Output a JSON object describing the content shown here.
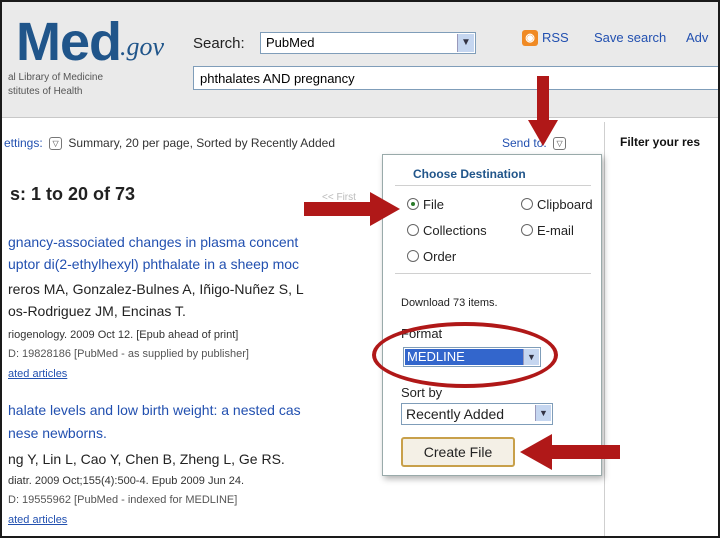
{
  "header": {
    "logo_main": "Med",
    "logo_suffix": ".gov",
    "logo_line1": "al Library of Medicine",
    "logo_line2": "stitutes of Health",
    "search_label": "Search:",
    "database_value": "PubMed",
    "query_value": "phthalates AND pregnancy",
    "rss_label": "RSS",
    "save_search_label": "Save search",
    "advanced_label": "Adv"
  },
  "toolbar": {
    "settings_link": "ettings:",
    "settings_text": "Summary, 20 per page, Sorted by Recently Added",
    "send_to_label": "Send to:",
    "filter_label": "Filter your res"
  },
  "results": {
    "heading": "s: 1 to 20 of 73",
    "faded_text": "<< First",
    "items": [
      {
        "title_line1": "gnancy-associated changes in plasma concent",
        "title_line2": "uptor di(2-ethylhexyl) phthalate in a sheep moc",
        "authors_line1": "reros MA, Gonzalez-Bulnes A, Iñigo-Nuñez S, L",
        "authors_line2": "os-Rodriguez JM, Encinas T.",
        "source": "riogenology. 2009 Oct 12. [Epub ahead of print]",
        "pmid": "D: 19828186 [PubMed - as supplied by publisher]",
        "related": "ated articles"
      },
      {
        "title_line1": "halate levels and low birth weight: a nested cas",
        "title_line2": "nese newborns.",
        "authors_line1": "ng Y, Lin L, Cao Y, Chen B, Zheng L, Ge RS.",
        "source": "diatr. 2009 Oct;155(4):500-4. Epub 2009 Jun 24.",
        "pmid": "D: 19555962 [PubMed - indexed for MEDLINE]",
        "related": "ated articles"
      }
    ]
  },
  "popup": {
    "title": "Choose Destination",
    "options": {
      "file": "File",
      "clipboard": "Clipboard",
      "collections": "Collections",
      "email": "E-mail",
      "order": "Order"
    },
    "selected": "File",
    "download_count": "Download 73 items.",
    "format_label": "Format",
    "format_value": "MEDLINE",
    "sort_label": "Sort by",
    "sort_value": "Recently Added",
    "create_button": "Create File"
  },
  "colors": {
    "annotation_red": "#b01818",
    "link_blue": "#2250b0",
    "brand_blue": "#20558a"
  }
}
